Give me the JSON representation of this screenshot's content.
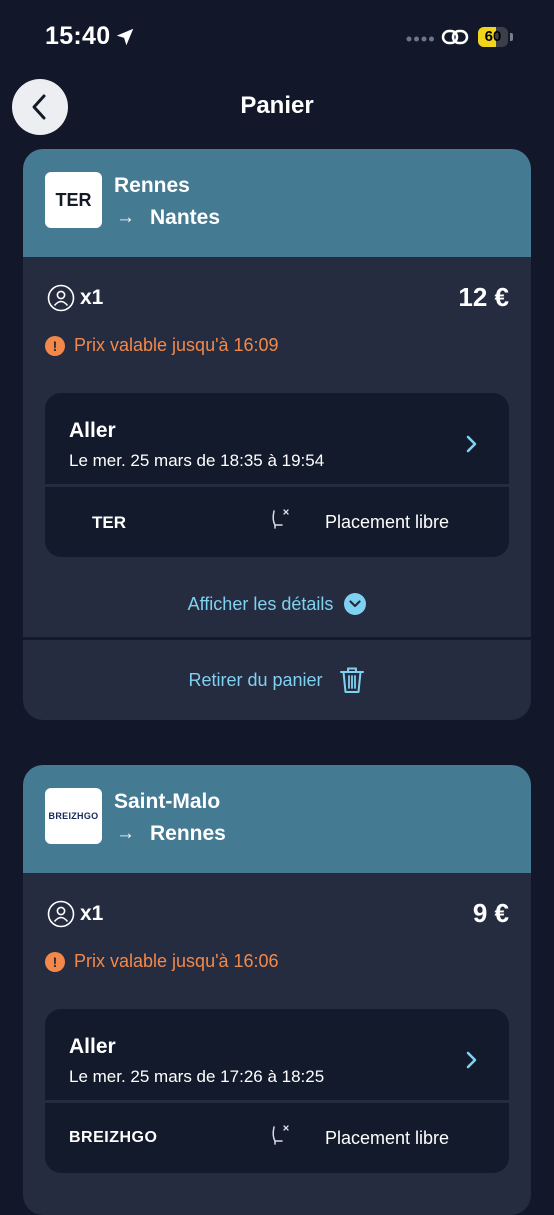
{
  "status_bar": {
    "time": "15:40",
    "battery": "60",
    "battery_level": 0.6
  },
  "header": {
    "title": "Panier"
  },
  "carts": [
    {
      "operator_logo": "TER",
      "origin": "Rennes",
      "destination": "Nantes",
      "arrow": "→",
      "passengers": "x1",
      "price": "12 €",
      "validity": "Prix valable jusqu'à 16:09",
      "journey": {
        "title": "Aller",
        "date": "Le mer. 25 mars de 18:35 à 19:54",
        "operator": "TER",
        "seat": "Placement libre"
      },
      "details_label": "Afficher les détails",
      "remove_label": "Retirer du panier"
    },
    {
      "operator_logo": "BREIZHGO",
      "origin": "Saint-Malo",
      "destination": "Rennes",
      "arrow": "→",
      "passengers": "x1",
      "price": "9 €",
      "validity": "Prix valable jusqu'à 16:06",
      "journey": {
        "title": "Aller",
        "date": "Le mer. 25 mars de 17:26 à 18:25",
        "operator": "BREIZHGO",
        "seat": "Placement libre"
      }
    }
  ],
  "colors": {
    "background": "#121829",
    "card": "#252c3f",
    "card_header": "#457a93",
    "accent_link": "#7fd1f2",
    "warning": "#f3884a",
    "battery": "#f1d51c"
  },
  "icons": [
    "location-arrow-icon",
    "link-icon",
    "battery-icon",
    "back-arrow-icon",
    "passenger-icon",
    "warning-icon",
    "chevron-right-icon",
    "seat-icon",
    "chevron-down-icon",
    "trash-icon"
  ]
}
